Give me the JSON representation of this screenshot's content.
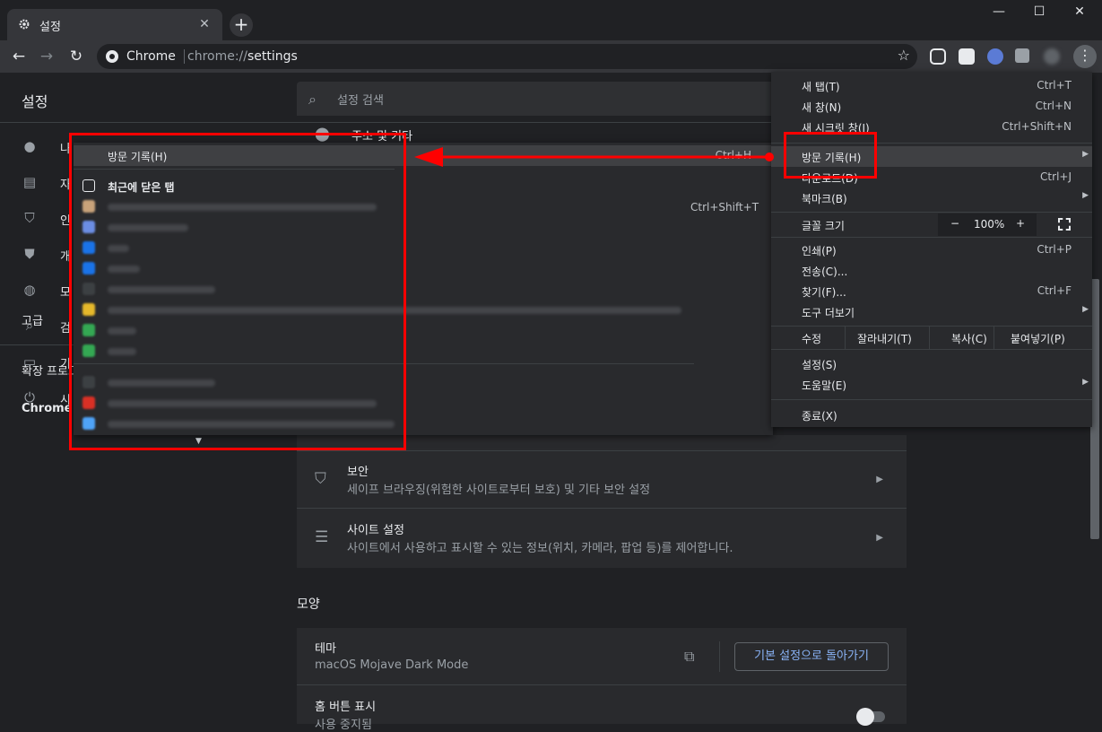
{
  "tab": {
    "title": "설정",
    "close": "✕"
  },
  "window": {
    "minimize": "—",
    "maximize": "☐",
    "close": "✕"
  },
  "toolbar": {
    "back": "←",
    "forward": "→",
    "reload": "↻",
    "origin": "Chrome",
    "url_prefix": "chrome://",
    "url_path": "settings",
    "star": "☆"
  },
  "settings": {
    "title": "설정",
    "search_placeholder": "설정 검색",
    "sidebar": [
      {
        "icon": "person-icon",
        "label": "나"
      },
      {
        "icon": "autofill-icon",
        "label": "자"
      },
      {
        "icon": "shield-check-icon",
        "label": "인"
      },
      {
        "icon": "shield-icon",
        "label": "개"
      },
      {
        "icon": "palette-icon",
        "label": "모"
      },
      {
        "icon": "search-icon",
        "label": "검"
      },
      {
        "icon": "browser-icon",
        "label": "기"
      },
      {
        "icon": "power-icon",
        "label": "시"
      }
    ],
    "advanced": "고급",
    "extensions": "확장 프로그램",
    "about": "Chrome 정보",
    "addresses_row": "주소 및 기타",
    "security": {
      "title": "보안",
      "subtitle": "세이프 브라우징(위험한 사이트로부터 보호) 및 기타 보안 설정"
    },
    "site_settings": {
      "title": "사이트 설정",
      "subtitle": "사이트에서 사용하고 표시할 수 있는 정보(위치, 카메라, 팝업 등)를 제어합니다."
    },
    "appearance_heading": "모양",
    "theme": {
      "title": "테마",
      "value": "macOS Mojave Dark Mode",
      "reset_button": "기본 설정으로 돌아가기"
    },
    "home_button": {
      "title": "홈 버튼 표시",
      "subtitle": "사용 중지됨"
    }
  },
  "main_menu": {
    "items": [
      {
        "label": "새 탭(T)",
        "shortcut": "Ctrl+T"
      },
      {
        "label": "새 창(N)",
        "shortcut": "Ctrl+N"
      },
      {
        "label": "새 시크릿 창(I)",
        "shortcut": "Ctrl+Shift+N"
      },
      {
        "label": "방문 기록(H)",
        "shortcut": ""
      },
      {
        "label": "다운로드(D)",
        "shortcut": "Ctrl+J"
      },
      {
        "label": "북마크(B)",
        "shortcut": ""
      },
      {
        "label": "인쇄(P)",
        "shortcut": "Ctrl+P"
      },
      {
        "label": "전송(C)...",
        "shortcut": ""
      },
      {
        "label": "찾기(F)...",
        "shortcut": "Ctrl+F"
      },
      {
        "label": "도구 더보기",
        "shortcut": ""
      },
      {
        "label": "설정(S)",
        "shortcut": ""
      },
      {
        "label": "도움말(E)",
        "shortcut": ""
      },
      {
        "label": "종료(X)",
        "shortcut": ""
      }
    ],
    "zoom": {
      "label": "글꼴 크기",
      "minus": "−",
      "value": "100%",
      "plus": "+"
    },
    "edit": {
      "label": "수정",
      "cut": "잘라내기(T)",
      "copy": "복사(C)",
      "paste": "붙여넣기(P)"
    }
  },
  "history_menu": {
    "history": {
      "label": "방문 기록(H)",
      "shortcut": "Ctrl+H"
    },
    "recently_closed": "최근에 닫은 탭",
    "reopen_shortcut": "Ctrl+Shift+T",
    "entries": [
      {
        "color": "#c8a27a",
        "w": 300
      },
      {
        "color": "#6b8de3",
        "w": 90
      },
      {
        "color": "#1a73e8",
        "w": 24
      },
      {
        "color": "#1a73e8",
        "w": 36
      },
      {
        "color": "#3c4043",
        "w": 120
      },
      {
        "color": "#e5b82b",
        "w": 640
      },
      {
        "color": "#34a853",
        "w": 32
      },
      {
        "color": "#34a853",
        "w": 32
      },
      {
        "color": "#3c4043",
        "w": 120
      },
      {
        "color": "#d93025",
        "w": 300
      },
      {
        "color": "#4fa3f7",
        "w": 320
      }
    ]
  },
  "colors": {
    "annotation": "#ff0000",
    "accent": "#8ab4f8"
  }
}
